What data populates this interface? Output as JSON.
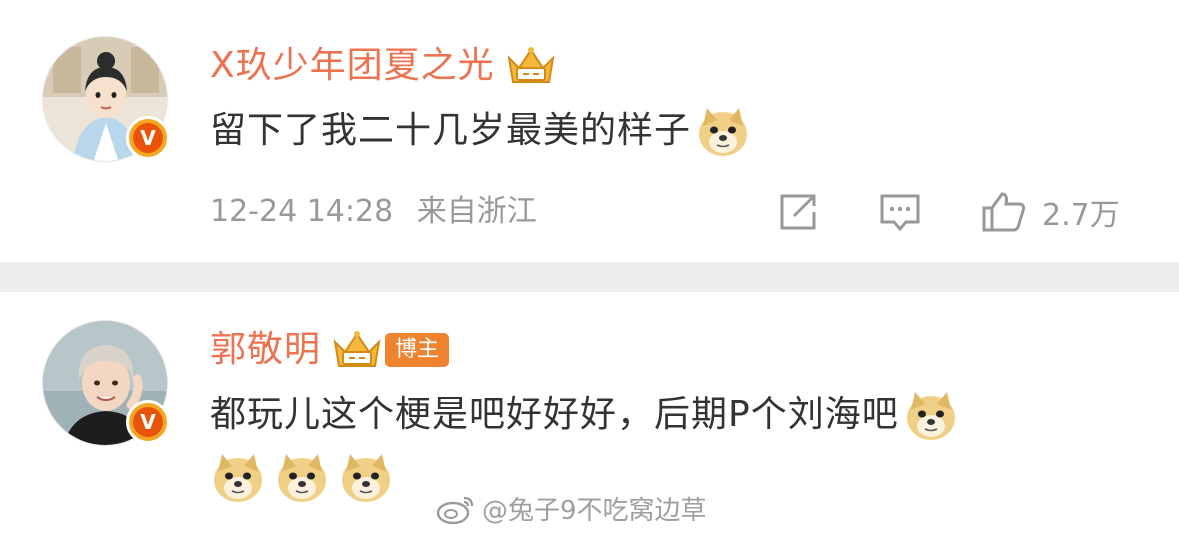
{
  "posts": [
    {
      "username": "X玖少年团夏之光",
      "content": "留下了我二十几岁最美的样子",
      "timestamp": "12-24 14:28",
      "location": "来自浙江",
      "likes": "2.7万",
      "avatar": "cartoon-character-avatar",
      "badge": "v-verified"
    },
    {
      "username": "郭敬明",
      "tag": "博主",
      "content": "都玩儿这个梗是吧好好好，后期P个刘海吧",
      "avatar": "person-photo-avatar",
      "badge": "v-verified"
    }
  ],
  "watermark": "@兔子9不吃窝边草",
  "colors": {
    "username": "#eb7350",
    "text": "#333333",
    "meta": "#999999",
    "divider": "#eeeeee",
    "badge": "#f5a623",
    "tag": "#f0832f"
  }
}
